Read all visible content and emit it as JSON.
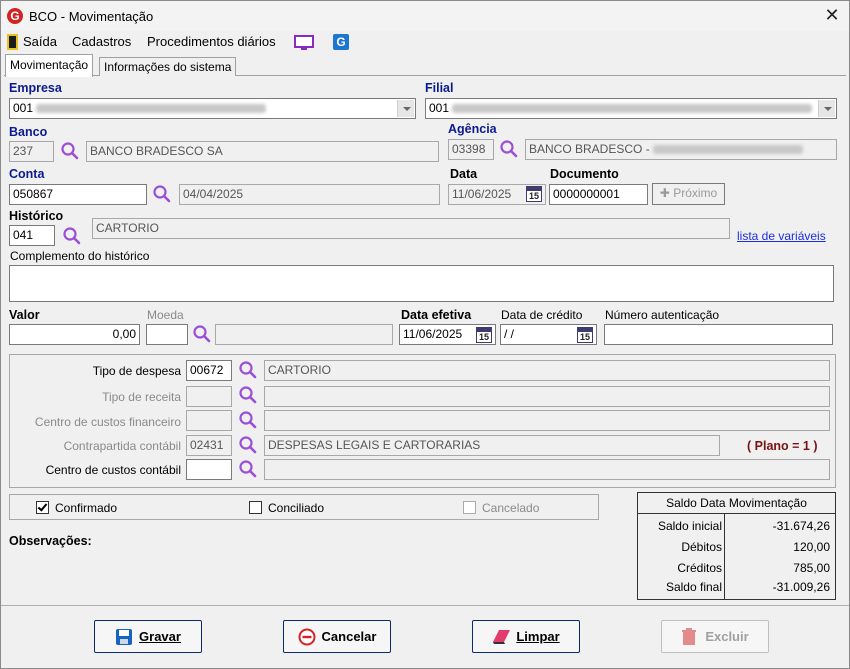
{
  "window": {
    "title": "BCO - Movimentação",
    "logo_letter": "G",
    "close_glyph": "✕"
  },
  "menu": {
    "items": [
      "Saída",
      "Cadastros",
      "Procedimentos diários"
    ]
  },
  "tabs": [
    "Movimentação",
    "Informações do sistema"
  ],
  "labels": {
    "empresa": "Empresa",
    "filial": "Filial",
    "banco": "Banco",
    "agencia": "Agência",
    "conta": "Conta",
    "data": "Data",
    "documento": "Documento",
    "historico": "Histórico",
    "lista_variaveis": "lista de variáveis",
    "complemento": "Complemento do histórico",
    "valor": "Valor",
    "moeda": "Moeda",
    "data_efetiva": "Data efetiva",
    "data_credito": "Data de crédito",
    "numero_autenticacao": "Número autenticação",
    "tipo_despesa": "Tipo de despesa",
    "tipo_receita": "Tipo de receita",
    "centro_custos_financeiro": "Centro de custos financeiro",
    "contrapartida_contabil": "Contrapartida contábil",
    "centro_custos_contabil": "Centro de custos contábil",
    "plano": "( Plano = 1 )",
    "observacoes": "Observações:"
  },
  "fields": {
    "empresa_code": "001",
    "filial_code": "001",
    "banco_code": "237",
    "banco_name": "BANCO BRADESCO SA",
    "agencia_code": "03398",
    "agencia_name": "BANCO BRADESCO -",
    "conta_code": "050867",
    "conta_date": "04/04/2025",
    "data": "11/06/2025",
    "documento": "0000000001",
    "proximo": "Próximo",
    "historico_code": "041",
    "historico_name": "CARTORIO",
    "complemento": "",
    "valor": "0,00",
    "moeda": "",
    "moeda_name": "",
    "data_efetiva": "11/06/2025",
    "data_credito": " /  /",
    "numero_autenticacao": "",
    "tipo_despesa_code": "00672",
    "tipo_despesa_name": "CARTORIO",
    "tipo_receita_code": "",
    "tipo_receita_name": "",
    "ccf_code": "",
    "ccf_name": "",
    "contrapartida_code": "02431",
    "contrapartida_name": "DESPESAS LEGAIS E CARTORARIAS",
    "ccc_code": "",
    "ccc_name": "",
    "calendar_glyph": "15"
  },
  "checks": {
    "confirmado": {
      "label": "Confirmado",
      "checked": true
    },
    "conciliado": {
      "label": "Conciliado",
      "checked": false
    },
    "cancelado": {
      "label": "Cancelado",
      "checked": false,
      "disabled": true
    }
  },
  "saldo": {
    "title": "Saldo Data Movimentação",
    "rows": [
      {
        "label": "Saldo inicial",
        "value": "-31.674,26"
      },
      {
        "label": "Débitos",
        "value": "120,00"
      },
      {
        "label": "Créditos",
        "value": "785,00"
      },
      {
        "label": "Saldo final",
        "value": "-31.009,26"
      }
    ]
  },
  "buttons": {
    "gravar": "Gravar",
    "cancelar": "Cancelar",
    "limpar": "Limpar",
    "excluir": "Excluir"
  },
  "colors": {
    "label_blue": "#0b1b8f",
    "search_purple": "#9b4fd6",
    "plano_red": "#7a1212",
    "logo_red": "#d32424"
  }
}
